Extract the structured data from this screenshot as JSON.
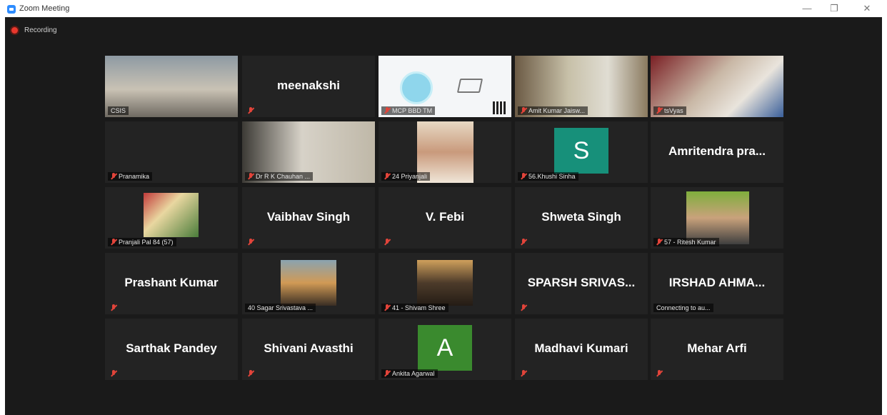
{
  "window": {
    "title": "Zoom Meeting",
    "minimize": "—",
    "restore": "❐",
    "close": "✕"
  },
  "recording": {
    "label": "Recording"
  },
  "tiles": [
    {
      "kind": "video",
      "caption": "CSIS",
      "muted": false,
      "active": true
    },
    {
      "kind": "name",
      "name": "meenakshi",
      "caption": "",
      "muted": true
    },
    {
      "kind": "screen",
      "caption": "MCP BBD TM",
      "muted": true
    },
    {
      "kind": "video",
      "caption": "Amit Kumar Jaisw...",
      "muted": true
    },
    {
      "kind": "video",
      "caption": "tsVyas",
      "muted": true
    },
    {
      "kind": "blank",
      "caption": "Pranamika",
      "muted": true
    },
    {
      "kind": "video",
      "caption": "Dr R K Chauhan ...",
      "muted": true
    },
    {
      "kind": "photo",
      "caption": "24 Priyanjali",
      "muted": true
    },
    {
      "kind": "avatar",
      "letter": "S",
      "avatar_color": "#17907a",
      "caption": "56.Khushi Sinha",
      "muted": true
    },
    {
      "kind": "name",
      "name": "Amritendra pra...",
      "caption": "",
      "muted": false
    },
    {
      "kind": "photo",
      "caption": "Pranjali Pal 84 (57)",
      "muted": true
    },
    {
      "kind": "name",
      "name": "Vaibhav Singh",
      "caption": "",
      "muted": true
    },
    {
      "kind": "name",
      "name": "V. Febi",
      "caption": "",
      "muted": true
    },
    {
      "kind": "name",
      "name": "Shweta Singh",
      "caption": "",
      "muted": true
    },
    {
      "kind": "photo",
      "caption": "57 - Ritesh Kumar",
      "muted": true
    },
    {
      "kind": "name",
      "name": "Prashant Kumar",
      "caption": "",
      "muted": true
    },
    {
      "kind": "photo",
      "caption": "40 Sagar Srivastava ...",
      "muted": false
    },
    {
      "kind": "photo",
      "caption": "41 - Shivam Shree",
      "muted": true
    },
    {
      "kind": "name",
      "name": "SPARSH SRIVAS...",
      "caption": "",
      "muted": true
    },
    {
      "kind": "name",
      "name": "IRSHAD AHMA...",
      "caption": "Connecting to au...",
      "muted": false
    },
    {
      "kind": "name",
      "name": "Sarthak Pandey",
      "caption": "",
      "muted": true
    },
    {
      "kind": "name",
      "name": "Shivani Avasthi",
      "caption": "",
      "muted": true
    },
    {
      "kind": "avatar",
      "letter": "A",
      "avatar_color": "#3a8a2e",
      "caption": "Ankita Agarwal",
      "muted": true
    },
    {
      "kind": "name",
      "name": "Madhavi Kumari",
      "caption": "",
      "muted": true
    },
    {
      "kind": "name",
      "name": "Mehar Arfi",
      "caption": "",
      "muted": true
    }
  ]
}
